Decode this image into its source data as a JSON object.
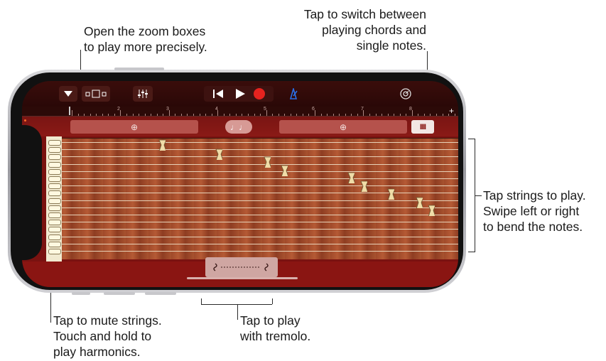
{
  "callouts": {
    "zoom": "Open the zoom boxes\nto play more precisely.",
    "switch": "Tap to switch between\nplaying chords and\nsingle notes.",
    "strings": "Tap strings to play.\nSwipe left or right\nto bend the notes.",
    "mute": "Tap to mute strings.\nTouch and hold to\nplay harmonics.",
    "tremolo": "Tap to play\nwith tremolo."
  },
  "toolbar": {
    "buttons": [
      "browser-menu",
      "views",
      "mixer",
      "rewind",
      "play",
      "record",
      "metronome",
      "settings"
    ]
  },
  "ruler": {
    "numbers": [
      "2",
      "3",
      "4",
      "5",
      "6",
      "7",
      "8"
    ],
    "add": "+"
  },
  "controls": {
    "zoom_glyph": "⊕",
    "chord_glyph": "♩♩",
    "mode_glyph": "IIII"
  },
  "colors": {
    "accent_red": "#e5231f",
    "metronome_blue": "#2a6fe8",
    "board": "#a8522f"
  }
}
